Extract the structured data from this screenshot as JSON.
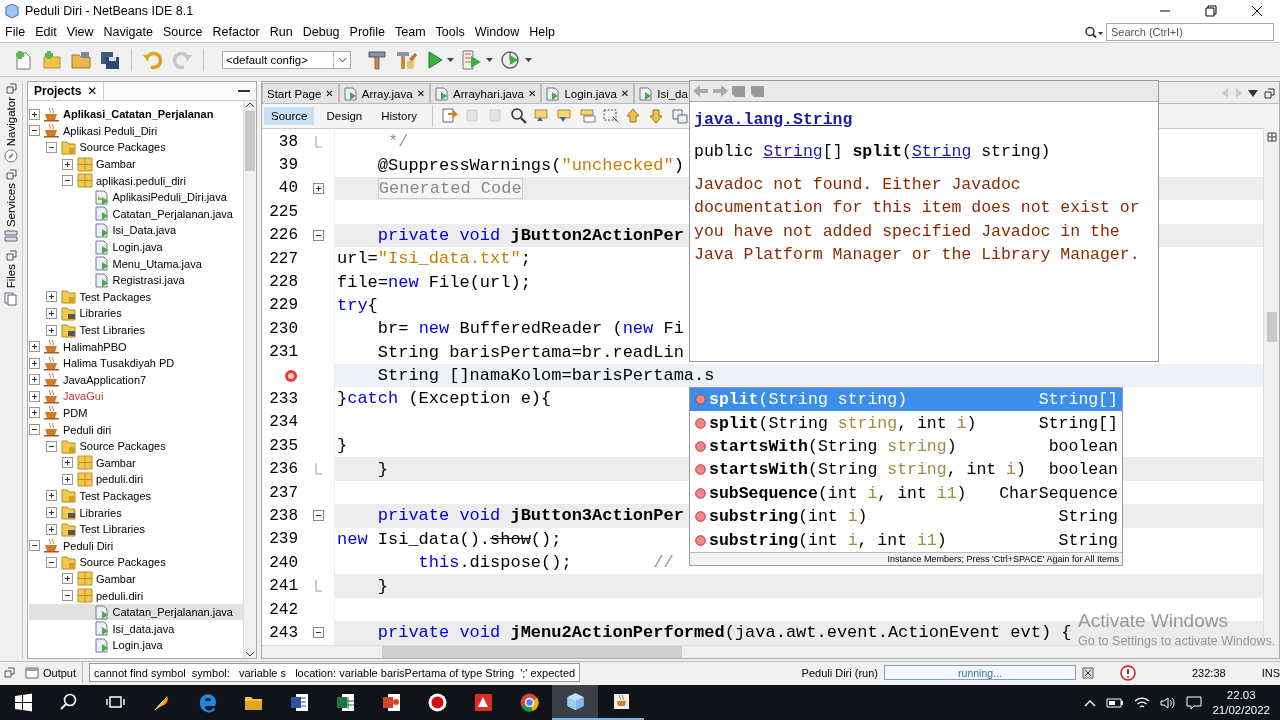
{
  "window": {
    "title": "Peduli Diri - NetBeans IDE 8.1"
  },
  "menu": [
    "File",
    "Edit",
    "View",
    "Navigate",
    "Source",
    "Refactor",
    "Run",
    "Debug",
    "Profile",
    "Team",
    "Tools",
    "Window",
    "Help"
  ],
  "search": {
    "placeholder": "Search (Ctrl+I)"
  },
  "toolbar": [
    {
      "kind": "new-file",
      "disabled": false,
      "menu": false
    },
    {
      "kind": "new-project",
      "disabled": false,
      "menu": false
    },
    {
      "kind": "open-project",
      "disabled": false,
      "menu": false
    },
    {
      "kind": "save-all",
      "disabled": false,
      "menu": false
    },
    {
      "kind": "separator"
    },
    {
      "kind": "undo",
      "disabled": false,
      "menu": false
    },
    {
      "kind": "redo",
      "disabled": true,
      "menu": false
    },
    {
      "kind": "separator"
    },
    {
      "kind": "config",
      "value": "<default config>"
    },
    {
      "kind": "build",
      "disabled": false,
      "menu": false
    },
    {
      "kind": "clean-build",
      "disabled": false,
      "menu": false
    },
    {
      "kind": "run",
      "disabled": false,
      "menu": true
    },
    {
      "kind": "debug",
      "disabled": false,
      "menu": true
    },
    {
      "kind": "profile",
      "disabled": false,
      "menu": true
    }
  ],
  "side_tabs": [
    {
      "label": "Navigator",
      "kind": "navigator"
    },
    {
      "label": "Services",
      "kind": "services"
    },
    {
      "label": "Files",
      "kind": "files"
    }
  ],
  "projects": {
    "title": "Projects",
    "close": "✕",
    "tree": [
      {
        "label": "Aplikasi_Catatan_Perjalanan",
        "kind": "project",
        "main": true,
        "broken": false,
        "expanded": false,
        "selected": false
      },
      {
        "label": "Aplikasi Peduli_Diri",
        "kind": "project",
        "main": false,
        "broken": false,
        "expanded": true,
        "selected": false,
        "children": [
          {
            "label": "Source Packages",
            "kind": "folder",
            "expanded": true,
            "selected": false,
            "children": [
              {
                "label": "Gambar",
                "kind": "package",
                "expanded": false,
                "selected": false
              },
              {
                "label": "aplikasi.peduli_diri",
                "kind": "package",
                "expanded": true,
                "selected": false,
                "children": [
                  {
                    "label": "AplikasiPeduli_Diri.java",
                    "kind": "main-file",
                    "selected": false
                  },
                  {
                    "label": "Catatan_Perjalanan.java",
                    "kind": "file",
                    "selected": false
                  },
                  {
                    "label": "Isi_Data.java",
                    "kind": "file",
                    "selected": false
                  },
                  {
                    "label": "Login.java",
                    "kind": "file",
                    "selected": false
                  },
                  {
                    "label": "Menu_Utama.java",
                    "kind": "file",
                    "selected": false
                  },
                  {
                    "label": "Registrasi.java",
                    "kind": "file",
                    "selected": false
                  }
                ]
              }
            ]
          },
          {
            "label": "Test Packages",
            "kind": "folder",
            "expanded": false,
            "selected": false
          },
          {
            "label": "Libraries",
            "kind": "library",
            "expanded": false,
            "selected": false
          },
          {
            "label": "Test Libraries",
            "kind": "library",
            "expanded": false,
            "selected": false
          }
        ]
      },
      {
        "label": "HalimahPBO",
        "kind": "project",
        "main": false,
        "broken": false,
        "expanded": false,
        "selected": false
      },
      {
        "label": "Halima Tusakdiyah PD",
        "kind": "project",
        "main": false,
        "broken": false,
        "expanded": false,
        "selected": false
      },
      {
        "label": "JavaApplication7",
        "kind": "project",
        "main": false,
        "broken": false,
        "expanded": false,
        "selected": false
      },
      {
        "label": "JavaGui",
        "kind": "project",
        "main": false,
        "broken": true,
        "expanded": false,
        "selected": false
      },
      {
        "label": "PDM",
        "kind": "project",
        "main": false,
        "broken": false,
        "expanded": false,
        "selected": false
      },
      {
        "label": "Peduli diri",
        "kind": "project",
        "main": false,
        "broken": false,
        "expanded": true,
        "selected": false,
        "children": [
          {
            "label": "Source Packages",
            "kind": "folder",
            "expanded": true,
            "selected": false,
            "children": [
              {
                "label": "Gambar",
                "kind": "package",
                "expanded": false,
                "selected": false
              },
              {
                "label": "peduli.diri",
                "kind": "package",
                "expanded": false,
                "selected": false
              }
            ]
          },
          {
            "label": "Test Packages",
            "kind": "folder",
            "expanded": false,
            "selected": false
          },
          {
            "label": "Libraries",
            "kind": "library",
            "expanded": false,
            "selected": false
          },
          {
            "label": "Test Libraries",
            "kind": "library",
            "expanded": false,
            "selected": false
          }
        ]
      },
      {
        "label": "Peduli Diri",
        "kind": "project",
        "main": false,
        "broken": false,
        "expanded": true,
        "selected": false,
        "children": [
          {
            "label": "Source Packages",
            "kind": "folder",
            "expanded": true,
            "selected": false,
            "children": [
              {
                "label": "Gambar",
                "kind": "package",
                "expanded": false,
                "selected": false
              },
              {
                "label": "peduli.diri",
                "kind": "package",
                "expanded": true,
                "selected": false,
                "children": [
                  {
                    "label": "Catatan_Perjalanan.java",
                    "kind": "file",
                    "selected": true
                  },
                  {
                    "label": "Isi_data.java",
                    "kind": "file",
                    "selected": false
                  },
                  {
                    "label": "Login.java",
                    "kind": "file",
                    "selected": false
                  }
                ]
              }
            ]
          }
        ]
      }
    ]
  },
  "editor": {
    "tabs": [
      {
        "label": "Start Page",
        "kind": "page",
        "close": "✕",
        "selected": false
      },
      {
        "label": "Array.java",
        "kind": "file",
        "close": "✕",
        "selected": false
      },
      {
        "label": "Arrayhari.java",
        "kind": "file",
        "close": "✕",
        "selected": false
      },
      {
        "label": "Login.java",
        "kind": "file",
        "close": "✕",
        "selected": false
      },
      {
        "label": "Isi_da",
        "kind": "file",
        "selected": false
      }
    ],
    "views": [
      {
        "label": "Source",
        "selected": true
      },
      {
        "label": "Design",
        "selected": false
      },
      {
        "label": "History",
        "selected": false
      }
    ],
    "tools": [
      {
        "kind": "last-edit",
        "disabled": false
      },
      {
        "kind": "back",
        "disabled": true
      },
      {
        "kind": "forward",
        "disabled": true
      },
      {
        "kind": "find",
        "disabled": false
      },
      {
        "kind": "prev-occurrence",
        "disabled": false
      },
      {
        "kind": "next-occurrence",
        "disabled": false
      },
      {
        "kind": "highlight",
        "disabled": false
      },
      {
        "kind": "rect-select",
        "disabled": false
      },
      {
        "kind": "shift-up",
        "disabled": false
      },
      {
        "kind": "shift-down",
        "disabled": false
      },
      {
        "kind": "bookmark",
        "disabled": false
      }
    ],
    "lines": [
      {
        "number": "38",
        "kind": "fold-end",
        "guarded": false,
        "current": false,
        "error": false,
        "tokens": [
          {
            "text": "     */",
            "kind": "comment"
          }
        ]
      },
      {
        "number": "39",
        "kind": "plain",
        "guarded": false,
        "current": false,
        "error": false,
        "tokens": [
          {
            "text": "    @SuppressWarnings(",
            "kind": "plain"
          },
          {
            "text": "\"unchecked\"",
            "kind": "string"
          },
          {
            "text": ")",
            "kind": "plain"
          }
        ]
      },
      {
        "number": "40",
        "kind": "fold-closed",
        "guarded": true,
        "current": false,
        "error": false,
        "tokens": [
          {
            "text": "Generated Code",
            "kind": "folded"
          }
        ]
      },
      {
        "number": "225",
        "kind": "plain",
        "guarded": false,
        "current": false,
        "error": false
      },
      {
        "number": "226",
        "kind": "fold-open",
        "guarded": true,
        "current": false,
        "error": false,
        "tokens": [
          {
            "text": "    private void ",
            "kind": "keyword"
          },
          {
            "text": "jButton2ActionPer",
            "kind": "bold"
          }
        ]
      },
      {
        "number": "227",
        "kind": "plain",
        "guarded": false,
        "current": false,
        "error": false,
        "tokens": [
          {
            "text": "url=",
            "kind": "plain"
          },
          {
            "text": "\"Isi_data.txt\"",
            "kind": "string"
          },
          {
            "text": ";",
            "kind": "plain"
          }
        ]
      },
      {
        "number": "228",
        "kind": "plain",
        "guarded": false,
        "current": false,
        "error": false,
        "tokens": [
          {
            "text": "file=",
            "kind": "plain"
          },
          {
            "text": "new",
            "kind": "keyword"
          },
          {
            "text": " File(url);",
            "kind": "plain"
          }
        ]
      },
      {
        "number": "229",
        "kind": "plain",
        "guarded": false,
        "current": false,
        "error": false,
        "tokens": [
          {
            "text": "try",
            "kind": "keyword"
          },
          {
            "text": "{",
            "kind": "plain"
          }
        ]
      },
      {
        "number": "230",
        "kind": "plain",
        "guarded": false,
        "current": false,
        "error": false,
        "tokens": [
          {
            "text": "    br= ",
            "kind": "plain"
          },
          {
            "text": "new",
            "kind": "keyword"
          },
          {
            "text": " BufferedReader (",
            "kind": "plain"
          },
          {
            "text": "new",
            "kind": "keyword"
          },
          {
            "text": " Fi",
            "kind": "plain"
          }
        ]
      },
      {
        "number": "231",
        "kind": "plain",
        "guarded": false,
        "current": false,
        "error": false,
        "tokens": [
          {
            "text": "    String barisPertama=br.readLin",
            "kind": "plain"
          }
        ]
      },
      {
        "kind": "plain",
        "guarded": false,
        "current": true,
        "error": true,
        "tokens": [
          {
            "text": "    String []namaKolom=barisPertama.s",
            "kind": "plain"
          }
        ]
      },
      {
        "number": "233",
        "kind": "plain",
        "guarded": false,
        "current": false,
        "error": false,
        "tokens": [
          {
            "text": "}",
            "kind": "plain"
          },
          {
            "text": "catch",
            "kind": "keyword"
          },
          {
            "text": " (Exception e){",
            "kind": "plain"
          }
        ]
      },
      {
        "number": "234",
        "kind": "plain",
        "guarded": false,
        "current": false,
        "error": false
      },
      {
        "number": "235",
        "kind": "plain",
        "guarded": false,
        "current": false,
        "error": false,
        "tokens": [
          {
            "text": "}",
            "kind": "plain"
          }
        ]
      },
      {
        "number": "236",
        "kind": "fold-end",
        "guarded": true,
        "current": false,
        "error": false,
        "tokens": [
          {
            "text": "    }",
            "kind": "plain"
          }
        ]
      },
      {
        "number": "237",
        "kind": "plain",
        "guarded": false,
        "current": false,
        "error": false
      },
      {
        "number": "238",
        "kind": "fold-open",
        "guarded": true,
        "current": false,
        "error": false,
        "tokens": [
          {
            "text": "    private void ",
            "kind": "keyword"
          },
          {
            "text": "jButton3ActionPer",
            "kind": "bold"
          }
        ]
      },
      {
        "number": "239",
        "kind": "plain",
        "guarded": false,
        "current": false,
        "error": false,
        "tokens": [
          {
            "text": "new",
            "kind": "keyword"
          },
          {
            "text": " Isi_data().",
            "kind": "plain"
          },
          {
            "text": "show",
            "kind": "deprecated"
          },
          {
            "text": "();",
            "kind": "plain"
          }
        ]
      },
      {
        "number": "240",
        "kind": "plain",
        "guarded": false,
        "current": false,
        "error": false,
        "tokens": [
          {
            "text": "        this",
            "kind": "keyword"
          },
          {
            "text": ".dispose();        ",
            "kind": "plain"
          },
          {
            "text": "//",
            "kind": "comment"
          }
        ]
      },
      {
        "number": "241",
        "kind": "fold-end",
        "guarded": true,
        "current": false,
        "error": false,
        "tokens": [
          {
            "text": "    }",
            "kind": "plain"
          }
        ]
      },
      {
        "number": "242",
        "kind": "plain",
        "guarded": false,
        "current": false,
        "error": false
      },
      {
        "number": "243",
        "kind": "fold-open",
        "guarded": true,
        "current": false,
        "error": false,
        "tokens": [
          {
            "text": "    private void ",
            "kind": "keyword"
          },
          {
            "text": "jMenu2ActionPerformed",
            "kind": "bold"
          },
          {
            "text": "(java.awt.event.ActionEvent evt) {",
            "kind": "plain"
          }
        ]
      }
    ]
  },
  "javadoc": {
    "class_link": "java.lang.String",
    "signature": [
      {
        "text": "public ",
        "kind": "plain"
      },
      {
        "text": "String",
        "kind": "link"
      },
      {
        "text": "[] ",
        "kind": "plain"
      },
      {
        "text": "split",
        "kind": "bold"
      },
      {
        "text": "(",
        "kind": "plain"
      },
      {
        "text": "String",
        "kind": "link"
      },
      {
        "text": " string)",
        "kind": "plain"
      }
    ],
    "message": "Javadoc not found. Either Javadoc documentation for this item does not exist or you have not added specified Javadoc in the Java Platform Manager or the Library Manager."
  },
  "completion": {
    "items": [
      {
        "name": "split",
        "params": [
          {
            "text": "(String string)",
            "kind": "type"
          }
        ],
        "type": "String[]",
        "selected": true
      },
      {
        "name": "split",
        "params": [
          {
            "text": "(String ",
            "kind": "type"
          },
          {
            "text": "string",
            "kind": "param"
          },
          {
            "text": ", int ",
            "kind": "type"
          },
          {
            "text": "i",
            "kind": "param"
          },
          {
            "text": ")",
            "kind": "type"
          }
        ],
        "type": "String[]",
        "selected": false
      },
      {
        "name": "startsWith",
        "params": [
          {
            "text": "(String ",
            "kind": "type"
          },
          {
            "text": "string",
            "kind": "param"
          },
          {
            "text": ")",
            "kind": "type"
          }
        ],
        "type": "boolean",
        "selected": false
      },
      {
        "name": "startsWith",
        "params": [
          {
            "text": "(String ",
            "kind": "type"
          },
          {
            "text": "string",
            "kind": "param"
          },
          {
            "text": ", int ",
            "kind": "type"
          },
          {
            "text": "i",
            "kind": "param"
          },
          {
            "text": ")",
            "kind": "type"
          }
        ],
        "type": "boolean",
        "selected": false
      },
      {
        "name": "subSequence",
        "params": [
          {
            "text": "(int ",
            "kind": "type"
          },
          {
            "text": "i",
            "kind": "param"
          },
          {
            "text": ", int ",
            "kind": "type"
          },
          {
            "text": "i1",
            "kind": "param"
          },
          {
            "text": ")",
            "kind": "type"
          }
        ],
        "type": "CharSequence",
        "selected": false
      },
      {
        "name": "substring",
        "params": [
          {
            "text": "(int ",
            "kind": "type"
          },
          {
            "text": "i",
            "kind": "param"
          },
          {
            "text": ")",
            "kind": "type"
          }
        ],
        "type": "String",
        "selected": false
      },
      {
        "name": "substring",
        "params": [
          {
            "text": "(int ",
            "kind": "type"
          },
          {
            "text": "i",
            "kind": "param"
          },
          {
            "text": ", int ",
            "kind": "type"
          },
          {
            "text": "i1",
            "kind": "param"
          },
          {
            "text": ")",
            "kind": "type"
          }
        ],
        "type": "String",
        "selected": false
      }
    ],
    "footer": "Instance Members; Press 'Ctrl+SPACE' Again for All Items"
  },
  "output": {
    "tab": "Output",
    "message": "cannot find symbol  symbol:   variable s   location: variable barisPertama of type String  ';' expected"
  },
  "status": {
    "project": "Peduli Diri (run)",
    "progress": "running...",
    "position": "232:38",
    "mode": "INS"
  },
  "activation": {
    "title": "Activate Windows",
    "subtitle": "Go to Settings to activate Windows."
  },
  "taskbar": {
    "apps": [
      {
        "kind": "start",
        "active": false,
        "running": false
      },
      {
        "kind": "search",
        "active": false,
        "running": false
      },
      {
        "kind": "task-view",
        "active": false,
        "running": false
      },
      {
        "kind": "feather",
        "active": false,
        "running": false
      },
      {
        "kind": "browser",
        "active": false,
        "running": false
      },
      {
        "kind": "folder",
        "active": false,
        "running": false
      },
      {
        "kind": "word",
        "active": false,
        "running": false
      },
      {
        "kind": "sheet",
        "active": false,
        "running": false
      },
      {
        "kind": "slides",
        "active": false,
        "running": false
      },
      {
        "kind": "record",
        "active": false,
        "running": false
      },
      {
        "kind": "red-app",
        "active": false,
        "running": false
      },
      {
        "kind": "chrome",
        "active": false,
        "running": false
      },
      {
        "kind": "cube",
        "active": true,
        "running": true
      },
      {
        "kind": "cup",
        "active": false,
        "running": true
      }
    ],
    "time": "22.03",
    "date": "21/02/2022"
  }
}
